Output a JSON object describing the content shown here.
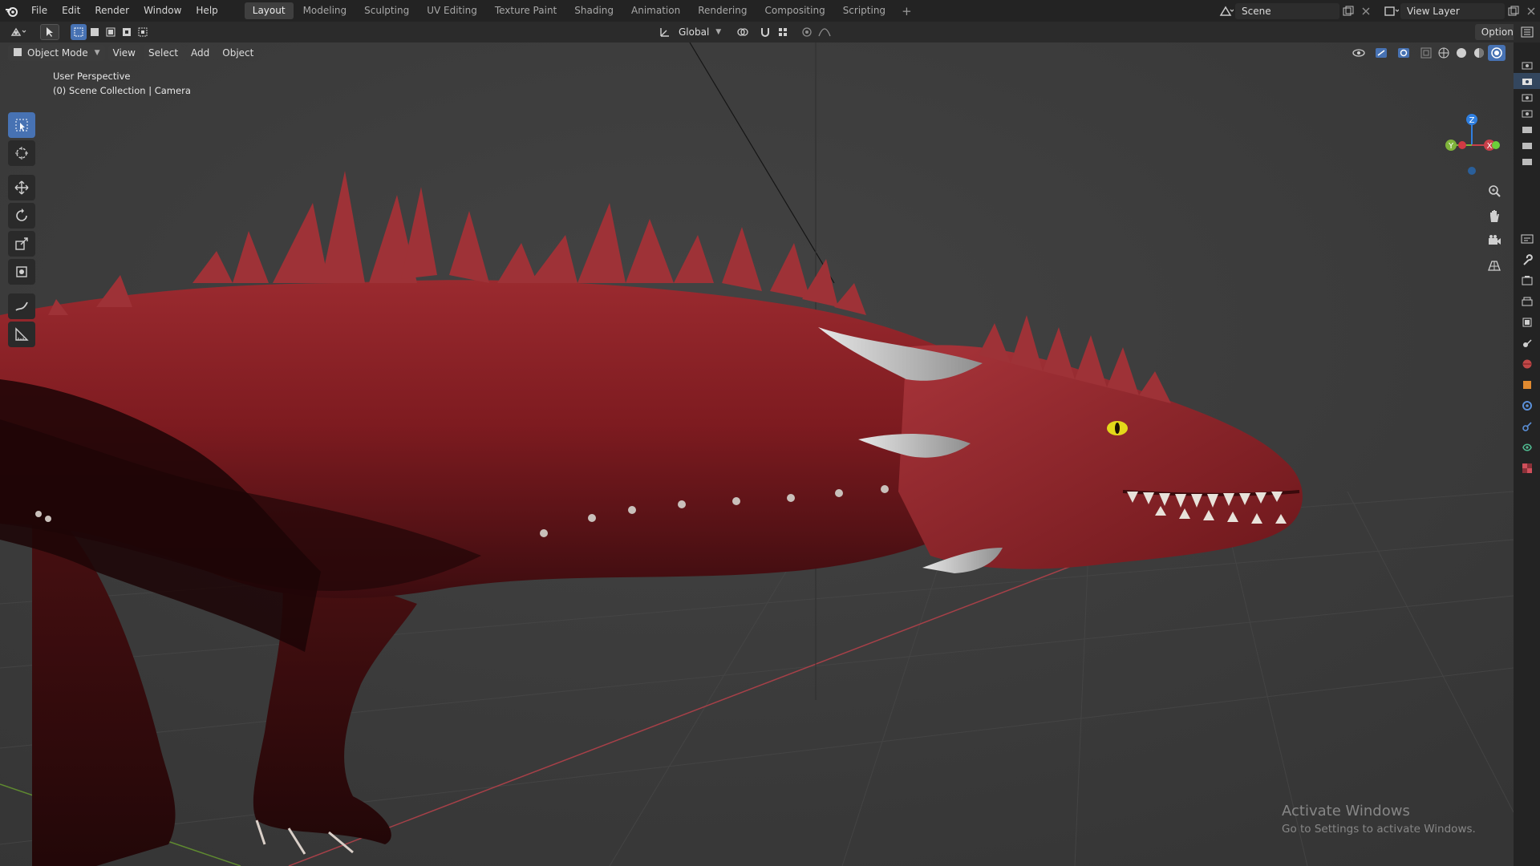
{
  "menus": [
    "File",
    "Edit",
    "Render",
    "Window",
    "Help"
  ],
  "workspaces": [
    "Layout",
    "Modeling",
    "Sculpting",
    "UV Editing",
    "Texture Paint",
    "Shading",
    "Animation",
    "Rendering",
    "Compositing",
    "Scripting"
  ],
  "active_workspace": "Layout",
  "scene_name": "Scene",
  "view_layer_name": "View Layer",
  "header": {
    "transform_orientation": "Global",
    "options_label": "Options"
  },
  "viewport_header": {
    "mode": "Object Mode",
    "view": "View",
    "select": "Select",
    "add": "Add",
    "object": "Object"
  },
  "viewport_info": {
    "line1": "User Perspective",
    "line2": "(0) Scene Collection | Camera"
  },
  "gizmo_axes": {
    "z": "Z",
    "y": "Y",
    "x": "X"
  },
  "tools": [
    "select-box-tool",
    "cursor-tool",
    "move-tool",
    "rotate-tool",
    "scale-tool",
    "transform-tool",
    "annotate-tool",
    "measure-tool"
  ],
  "watermark": {
    "title": "Activate Windows",
    "subtitle": "Go to Settings to activate Windows."
  },
  "colors": {
    "accent": "#4772b3",
    "dragon_red": "#7a1a1e",
    "horn": "#bdbdbd",
    "eye": "#e4d81a",
    "axis_x": "#c8404a",
    "axis_y": "#7fb43a",
    "axis_z": "#2f7fe0"
  }
}
